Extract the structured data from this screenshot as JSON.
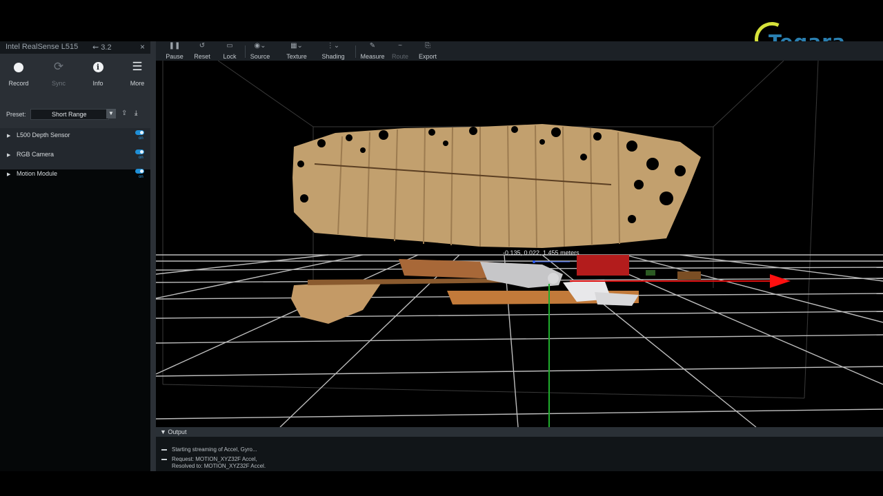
{
  "logo": {
    "text": "Tegara"
  },
  "device_panel": {
    "title": "Intel RealSense L515",
    "usb_label": "3.2",
    "close_symbol": "×",
    "toolbar": [
      {
        "label": "Record",
        "icon": "record-icon",
        "enabled": true
      },
      {
        "label": "Sync",
        "icon": "sync-icon",
        "enabled": false
      },
      {
        "label": "Info",
        "icon": "info-icon",
        "enabled": true
      },
      {
        "label": "More",
        "icon": "menu-icon",
        "enabled": true
      }
    ],
    "preset": {
      "label": "Preset:",
      "value": "Short Range"
    },
    "sensors": [
      {
        "label": "L500 Depth Sensor",
        "state": "on"
      },
      {
        "label": "RGB Camera",
        "state": "on"
      },
      {
        "label": "Motion Module",
        "state": "on"
      }
    ]
  },
  "viewer_toolbar": [
    {
      "label": "Pause",
      "icon": "pause-icon",
      "enabled": true
    },
    {
      "label": "Reset",
      "icon": "reset-icon",
      "enabled": true
    },
    {
      "label": "Lock",
      "icon": "lock-icon",
      "enabled": true
    },
    {
      "label": "Source",
      "icon": "source-icon",
      "enabled": true
    },
    {
      "label": "Texture",
      "icon": "texture-icon",
      "enabled": true
    },
    {
      "label": "Shading",
      "icon": "shading-icon",
      "enabled": true
    },
    {
      "label": "Measure",
      "icon": "measure-icon",
      "enabled": true
    },
    {
      "label": "Route",
      "icon": "route-icon",
      "enabled": false
    },
    {
      "label": "Export",
      "icon": "export-icon",
      "enabled": true
    }
  ],
  "viewport": {
    "measurement": "-0.135, 0.022, 1.455 meters"
  },
  "output": {
    "title": "Output",
    "lines": [
      "Starting streaming of Accel, Gyro...",
      "Request: MOTION_XYZ32F Accel,",
      "Resolved to: MOTION_XYZ32F Accel."
    ]
  },
  "colors": {
    "accent": "#1f8fd6",
    "logo_ring": "#d6e23a",
    "logo_text": "#2a7fb0",
    "x_axis": "#e01010",
    "y_axis": "#1fae2c"
  }
}
